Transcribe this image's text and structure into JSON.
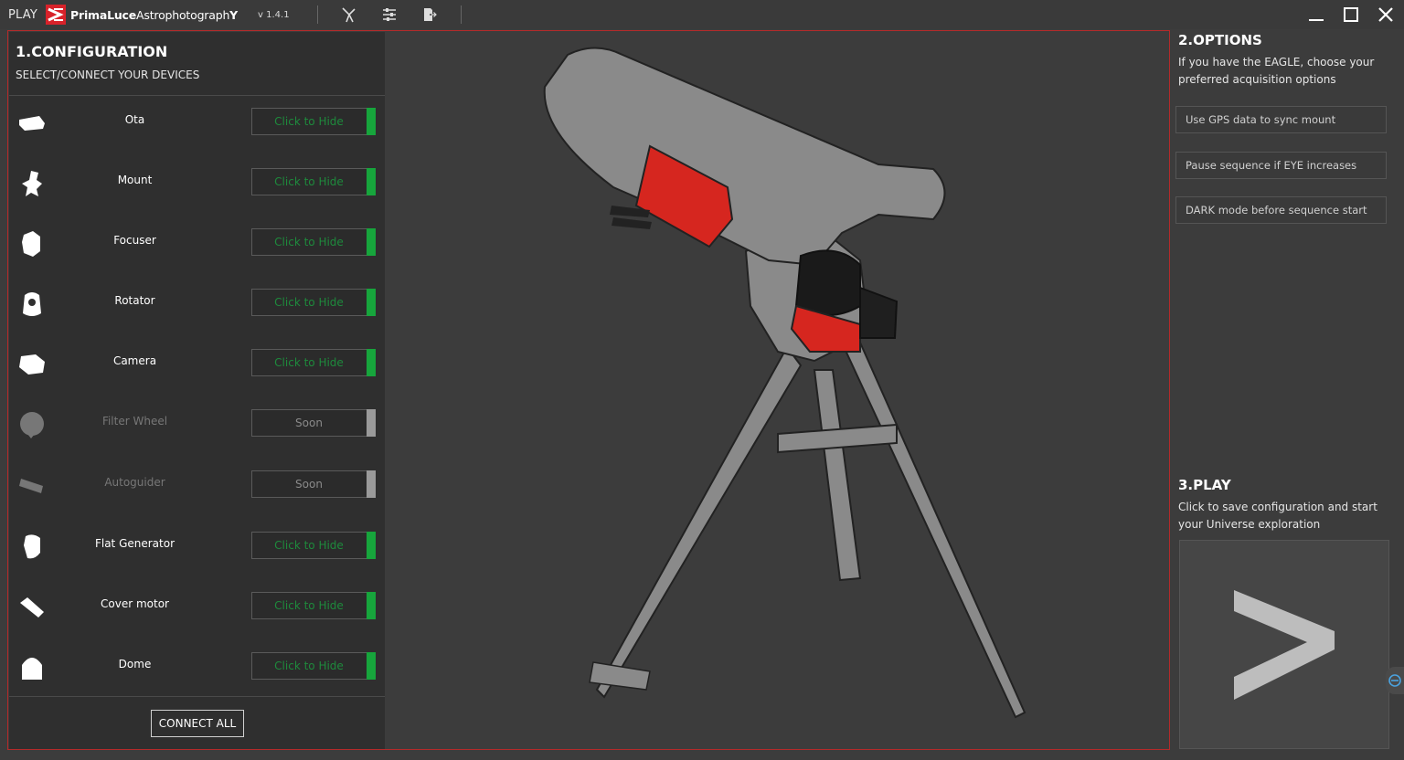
{
  "titlebar": {
    "app_name": "PLAY",
    "brand_bold": "PrimaLuce",
    "brand_mid": "Astrophotograph",
    "brand_end": "Y",
    "version": "v 1.4.1",
    "icons": [
      "telescope-tool-icon",
      "sliders-icon",
      "export-icon"
    ]
  },
  "configuration": {
    "title": "1.CONFIGURATION",
    "subtitle": "SELECT/CONNECT YOUR DEVICES",
    "devices": [
      {
        "label": "Ota",
        "button": "Click to Hide",
        "enabled": true
      },
      {
        "label": "Mount",
        "button": "Click to Hide",
        "enabled": true
      },
      {
        "label": "Focuser",
        "button": "Click to Hide",
        "enabled": true
      },
      {
        "label": "Rotator",
        "button": "Click to Hide",
        "enabled": true
      },
      {
        "label": "Camera",
        "button": "Click to Hide",
        "enabled": true
      },
      {
        "label": "Filter Wheel",
        "button": "Soon",
        "enabled": false
      },
      {
        "label": "Autoguider",
        "button": "Soon",
        "enabled": false
      },
      {
        "label": "Flat Generator",
        "button": "Click to Hide",
        "enabled": true
      },
      {
        "label": "Cover motor",
        "button": "Click to Hide",
        "enabled": true
      },
      {
        "label": "Dome",
        "button": "Click to Hide",
        "enabled": true
      }
    ],
    "connect_all": "CONNECT ALL"
  },
  "options": {
    "title": "2.OPTIONS",
    "description": "If you have the EAGLE, choose your preferred acquisition options",
    "buttons": [
      "Use GPS data to sync mount",
      "Pause sequence if EYE increases",
      "DARK mode before sequence start"
    ]
  },
  "play": {
    "title": "3.PLAY",
    "description": "Click to save configuration and start your Universe exploration"
  },
  "colors": {
    "accent_red": "#b42a2a",
    "active_green": "#17a53c",
    "panel_bg": "#2f2f2f"
  }
}
